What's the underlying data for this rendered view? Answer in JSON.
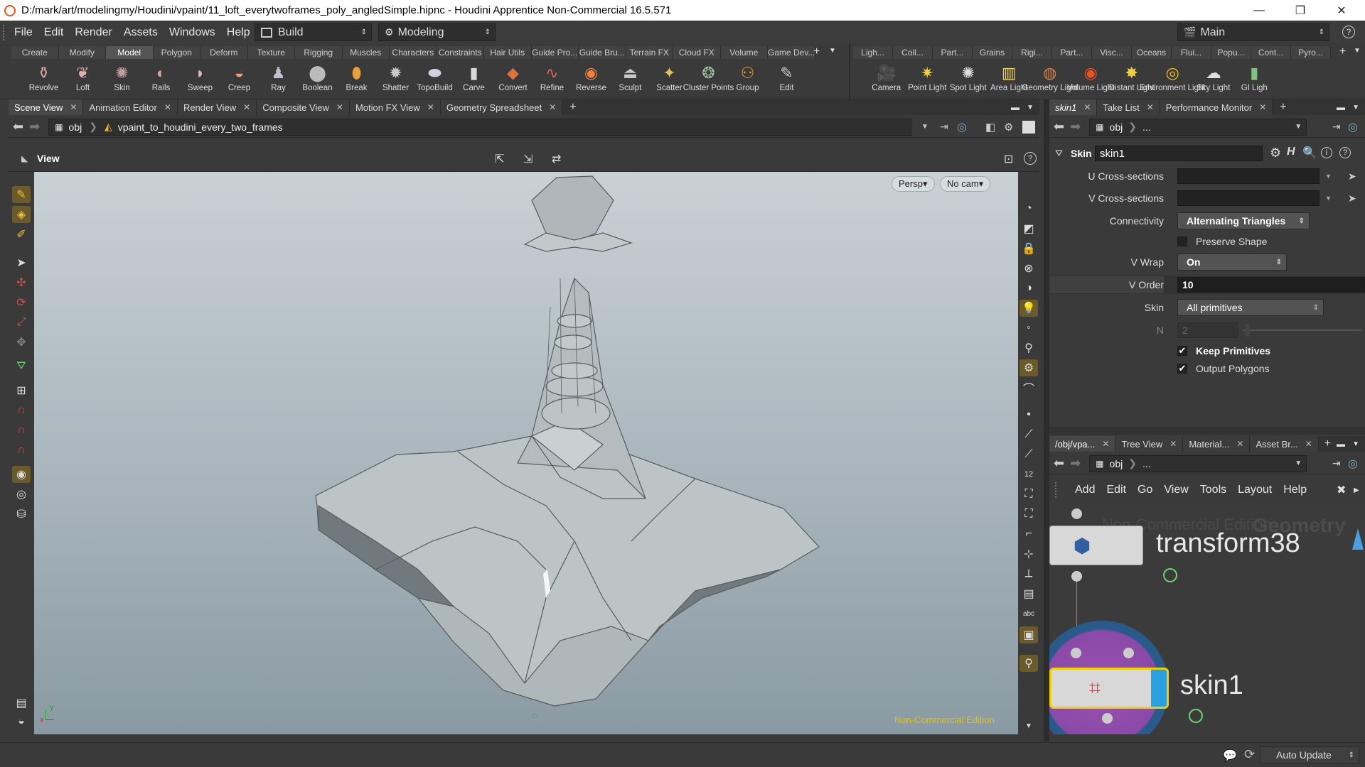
{
  "window": {
    "title": "D:/mark/art/modelingmy/Houdini/vpaint/11_loft_everytwoframes_poly_angledSimple.hipnc - Houdini Apprentice Non-Commercial 16.5.571",
    "minimize": "—",
    "maximize": "❐",
    "close": "✕"
  },
  "menubar": {
    "items": [
      "File",
      "Edit",
      "Render",
      "Assets",
      "Windows",
      "Help"
    ],
    "desktop": "Build",
    "context": "Modeling",
    "main_desktop": "Main",
    "help": "?"
  },
  "shelf": {
    "left_tabs": [
      "Create",
      "Modify",
      "Model",
      "Polygon",
      "Deform",
      "Texture",
      "Rigging",
      "Muscles",
      "Characters",
      "Constraints",
      "Hair Utils",
      "Guide Pro...",
      "Guide Bru...",
      "Terrain FX",
      "Cloud FX",
      "Volume",
      "Game Dev..."
    ],
    "active_tab": "Model",
    "left_tools": [
      {
        "label": "Revolve",
        "icon": "revolve-icon",
        "glyph": "⚱",
        "color": "#d9a0a0"
      },
      {
        "label": "Loft",
        "icon": "loft-icon",
        "glyph": "❦",
        "color": "#e0b0b0"
      },
      {
        "label": "Skin",
        "icon": "skin-icon",
        "glyph": "✺",
        "color": "#c8a0a0"
      },
      {
        "label": "Rails",
        "icon": "rails-icon",
        "glyph": "◐",
        "color": "#e0a0a0"
      },
      {
        "label": "Sweep",
        "icon": "sweep-icon",
        "glyph": "◗",
        "color": "#e7b8b8"
      },
      {
        "label": "Creep",
        "icon": "creep-icon",
        "glyph": "◒",
        "color": "#f0a070"
      },
      {
        "label": "Ray",
        "icon": "ray-icon",
        "glyph": "♟",
        "color": "#c0c0d0"
      },
      {
        "label": "Boolean",
        "icon": "boolean-icon",
        "glyph": "⬤",
        "color": "#bbbbbb"
      },
      {
        "label": "Break",
        "icon": "break-icon",
        "glyph": "⬮",
        "color": "#e8a040"
      },
      {
        "label": "Shatter",
        "icon": "shatter-icon",
        "glyph": "✹",
        "color": "#c8c8c8"
      },
      {
        "label": "TopoBuild",
        "icon": "topobuild-icon",
        "glyph": "⬬",
        "color": "#d0d0e0"
      },
      {
        "label": "Carve",
        "icon": "carve-icon",
        "glyph": "▮",
        "color": "#d8d8d8"
      },
      {
        "label": "Convert",
        "icon": "convert-icon",
        "glyph": "◆",
        "color": "#e07040"
      },
      {
        "label": "Refine",
        "icon": "refine-icon",
        "glyph": "∿",
        "color": "#e06060"
      },
      {
        "label": "Reverse",
        "icon": "reverse-icon",
        "glyph": "◉",
        "color": "#f08040"
      },
      {
        "label": "Sculpt",
        "icon": "sculpt-icon",
        "glyph": "⏏",
        "color": "#c8c8c8"
      },
      {
        "label": "Scatter",
        "icon": "scatter-icon",
        "glyph": "✦",
        "color": "#e0c060"
      },
      {
        "label": "Cluster Points",
        "icon": "cluster-points-icon",
        "glyph": "❂",
        "color": "#a0c0a0"
      },
      {
        "label": "Group",
        "icon": "group-icon",
        "glyph": "⚇",
        "color": "#e0a040"
      },
      {
        "label": "Edit",
        "icon": "edit-icon",
        "glyph": "✎",
        "color": "#c8c8c8"
      }
    ],
    "right_tabs": [
      "Ligh...",
      "Coll...",
      "Part...",
      "Grains",
      "Rigi...",
      "Part...",
      "Visc...",
      "Oceans",
      "Flui...",
      "Popu...",
      "Cont...",
      "Pyro..."
    ],
    "right_tools": [
      {
        "label": "Camera",
        "icon": "camera-icon",
        "glyph": "🎥",
        "color": "#c8c8c8"
      },
      {
        "label": "Point Light",
        "icon": "point-light-icon",
        "glyph": "✷",
        "color": "#f0d040"
      },
      {
        "label": "Spot Light",
        "icon": "spot-light-icon",
        "glyph": "✺",
        "color": "#e0e0e0"
      },
      {
        "label": "Area Light",
        "icon": "area-light-icon",
        "glyph": "▥",
        "color": "#f0d060"
      },
      {
        "label": "Geometry Light",
        "icon": "geometry-light-icon",
        "glyph": "◍",
        "color": "#e08040"
      },
      {
        "label": "Volume Light",
        "icon": "volume-light-icon",
        "glyph": "◉",
        "color": "#f05020"
      },
      {
        "label": "Distant Light",
        "icon": "distant-light-icon",
        "glyph": "✸",
        "color": "#f0d040"
      },
      {
        "label": "Environment Light",
        "icon": "environment-light-icon",
        "glyph": "◎",
        "color": "#f0c020"
      },
      {
        "label": "Sky Light",
        "icon": "sky-light-icon",
        "glyph": "☁",
        "color": "#e0e0e0"
      },
      {
        "label": "GI Ligh",
        "icon": "gi-light-icon",
        "glyph": "▮",
        "color": "#80c080"
      }
    ]
  },
  "scene_tabs": [
    {
      "label": "Scene View",
      "active": true
    },
    {
      "label": "Animation Editor"
    },
    {
      "label": "Render View"
    },
    {
      "label": "Composite View"
    },
    {
      "label": "Motion FX View"
    },
    {
      "label": "Geometry Spreadsheet"
    }
  ],
  "scene_path": {
    "root": "obj",
    "node": "vpaint_to_houdini_every_two_frames"
  },
  "viewport": {
    "title": "View",
    "persp": "Persp▾",
    "cam": "No cam▾",
    "watermark": "Non-Commercial Edition",
    "axis_x": "x",
    "axis_y": "y"
  },
  "param_tabs": [
    {
      "label": "skin1",
      "active": true
    },
    {
      "label": "Take List"
    },
    {
      "label": "Performance Monitor"
    }
  ],
  "param_path": {
    "root": "obj",
    "rest": "..."
  },
  "params": {
    "node_type": "Skin",
    "node_name": "skin1",
    "u_cross_label": "U Cross-sections",
    "u_cross_value": "",
    "v_cross_label": "V Cross-sections",
    "v_cross_value": "",
    "connectivity_label": "Connectivity",
    "connectivity_value": "Alternating Triangles",
    "preserve_shape_label": "Preserve Shape",
    "vwrap_label": "V Wrap",
    "vwrap_value": "On",
    "vorder_label": "V Order",
    "vorder_value": "10",
    "skin_label": "Skin",
    "skin_value": "All primitives",
    "n_label": "N",
    "n_value": "2",
    "keep_primitives_label": "Keep Primitives",
    "output_polygons_label": "Output Polygons"
  },
  "network_tabs": [
    {
      "label": "/obj/vpa...",
      "active": true
    },
    {
      "label": "Tree View"
    },
    {
      "label": "Material..."
    },
    {
      "label": "Asset Br..."
    }
  ],
  "network_path": {
    "root": "obj",
    "rest": "..."
  },
  "network_menu": [
    "Add",
    "Edit",
    "Go",
    "View",
    "Tools",
    "Layout",
    "Help"
  ],
  "network": {
    "watermark": "Non-Commercial Edition",
    "context_label": "Geometry",
    "node1": "transform38",
    "node2": "skin1"
  },
  "status": {
    "auto_update": "Auto Update"
  }
}
